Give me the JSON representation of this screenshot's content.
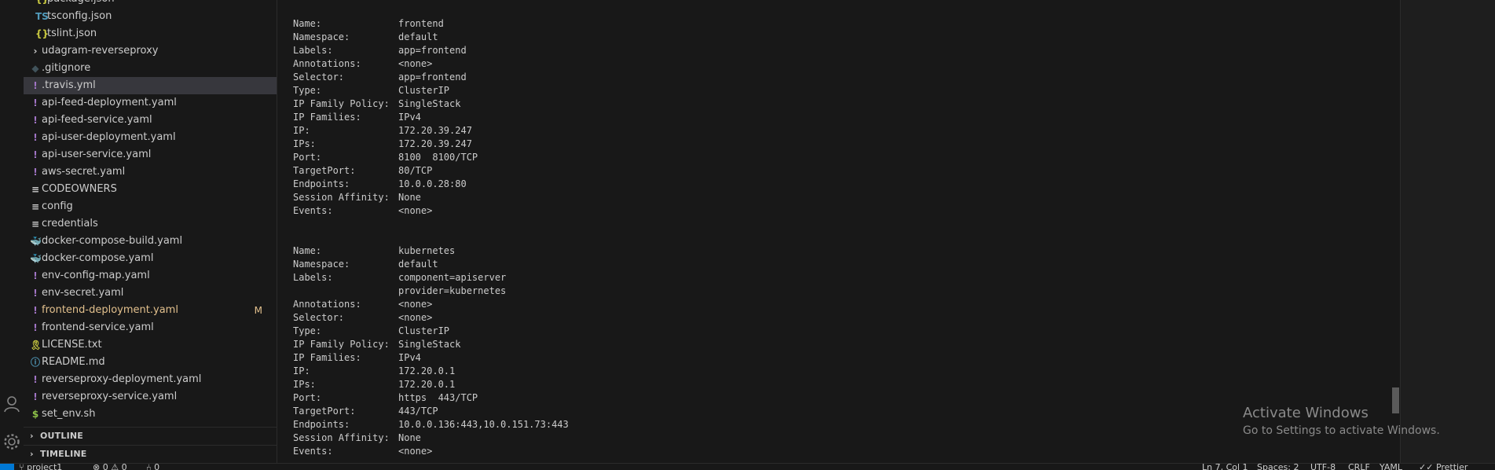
{
  "explorer": {
    "items": [
      {
        "icon": "json-icon",
        "glyph": "{}",
        "color": "#cbcb41",
        "label": "package.json",
        "indent": 2
      },
      {
        "icon": "tsconfig-icon",
        "glyph": "TS",
        "color": "#519aba",
        "label": "tsconfig.json",
        "indent": 2
      },
      {
        "icon": "json-icon",
        "glyph": "{}",
        "color": "#cbcb41",
        "label": "tslint.json",
        "indent": 2
      },
      {
        "icon": "chevron-right-icon",
        "glyph": "›",
        "color": "#cccccc",
        "label": "udagram-reverseproxy",
        "indent": 1
      },
      {
        "icon": "gitignore-icon",
        "glyph": "◆",
        "color": "#41535b",
        "label": ".gitignore",
        "indent": 1
      },
      {
        "icon": "yaml-icon",
        "glyph": "!",
        "color": "#a074c4",
        "label": ".travis.yml",
        "indent": 1,
        "selected": true
      },
      {
        "icon": "yaml-icon",
        "glyph": "!",
        "color": "#a074c4",
        "label": "api-feed-deployment.yaml",
        "indent": 1
      },
      {
        "icon": "yaml-icon",
        "glyph": "!",
        "color": "#a074c4",
        "label": "api-feed-service.yaml",
        "indent": 1
      },
      {
        "icon": "yaml-icon",
        "glyph": "!",
        "color": "#a074c4",
        "label": "api-user-deployment.yaml",
        "indent": 1
      },
      {
        "icon": "yaml-icon",
        "glyph": "!",
        "color": "#a074c4",
        "label": "api-user-service.yaml",
        "indent": 1
      },
      {
        "icon": "yaml-icon",
        "glyph": "!",
        "color": "#a074c4",
        "label": "aws-secret.yaml",
        "indent": 1
      },
      {
        "icon": "text-file-icon",
        "glyph": "≡",
        "color": "#cccccc",
        "label": "CODEOWNERS",
        "indent": 1
      },
      {
        "icon": "text-file-icon",
        "glyph": "≡",
        "color": "#cccccc",
        "label": "config",
        "indent": 1
      },
      {
        "icon": "text-file-icon",
        "glyph": "≡",
        "color": "#cccccc",
        "label": "credentials",
        "indent": 1
      },
      {
        "icon": "docker-icon",
        "glyph": "🐳",
        "color": "#e44d6a",
        "label": "docker-compose-build.yaml",
        "indent": 1
      },
      {
        "icon": "docker-icon",
        "glyph": "🐳",
        "color": "#e44d6a",
        "label": "docker-compose.yaml",
        "indent": 1
      },
      {
        "icon": "yaml-icon",
        "glyph": "!",
        "color": "#a074c4",
        "label": "env-config-map.yaml",
        "indent": 1
      },
      {
        "icon": "yaml-icon",
        "glyph": "!",
        "color": "#a074c4",
        "label": "env-secret.yaml",
        "indent": 1
      },
      {
        "icon": "yaml-icon",
        "glyph": "!",
        "color": "#a074c4",
        "label": "frontend-deployment.yaml",
        "indent": 1,
        "modified": true,
        "badge": "M"
      },
      {
        "icon": "yaml-icon",
        "glyph": "!",
        "color": "#a074c4",
        "label": "frontend-service.yaml",
        "indent": 1
      },
      {
        "icon": "license-icon",
        "glyph": "🎗",
        "color": "#cbcb41",
        "label": "LICENSE.txt",
        "indent": 1
      },
      {
        "icon": "info-icon",
        "glyph": "ⓘ",
        "color": "#519aba",
        "label": "README.md",
        "indent": 1
      },
      {
        "icon": "yaml-icon",
        "glyph": "!",
        "color": "#a074c4",
        "label": "reverseproxy-deployment.yaml",
        "indent": 1
      },
      {
        "icon": "yaml-icon",
        "glyph": "!",
        "color": "#a074c4",
        "label": "reverseproxy-service.yaml",
        "indent": 1
      },
      {
        "icon": "shell-icon",
        "glyph": "$",
        "color": "#8dc149",
        "label": "set_env.sh",
        "indent": 1
      }
    ]
  },
  "sections": {
    "outline": "OUTLINE",
    "timeline": "TIMELINE"
  },
  "terminal": {
    "services": [
      {
        "rows": [
          {
            "key": "Name:",
            "value": "frontend"
          },
          {
            "key": "Namespace:",
            "value": "default"
          },
          {
            "key": "Labels:",
            "value": "app=frontend"
          },
          {
            "key": "Annotations:",
            "value": "<none>"
          },
          {
            "key": "Selector:",
            "value": "app=frontend"
          },
          {
            "key": "Type:",
            "value": "ClusterIP"
          },
          {
            "key": "IP Family Policy:",
            "value": "SingleStack"
          },
          {
            "key": "IP Families:",
            "value": "IPv4"
          },
          {
            "key": "IP:",
            "value": "172.20.39.247"
          },
          {
            "key": "IPs:",
            "value": "172.20.39.247"
          },
          {
            "key": "Port:",
            "value": "8100  8100/TCP"
          },
          {
            "key": "TargetPort:",
            "value": "80/TCP"
          },
          {
            "key": "Endpoints:",
            "value": "10.0.0.28:80"
          },
          {
            "key": "Session Affinity:",
            "value": "None"
          },
          {
            "key": "Events:",
            "value": "<none>"
          }
        ]
      },
      {
        "rows": [
          {
            "key": "Name:",
            "value": "kubernetes"
          },
          {
            "key": "Namespace:",
            "value": "default"
          },
          {
            "key": "Labels:",
            "value": "component=apiserver"
          },
          {
            "key": "",
            "value": "provider=kubernetes"
          },
          {
            "key": "Annotations:",
            "value": "<none>"
          },
          {
            "key": "Selector:",
            "value": "<none>"
          },
          {
            "key": "Type:",
            "value": "ClusterIP"
          },
          {
            "key": "IP Family Policy:",
            "value": "SingleStack"
          },
          {
            "key": "IP Families:",
            "value": "IPv4"
          },
          {
            "key": "IP:",
            "value": "172.20.0.1"
          },
          {
            "key": "IPs:",
            "value": "172.20.0.1"
          },
          {
            "key": "Port:",
            "value": "https  443/TCP"
          },
          {
            "key": "TargetPort:",
            "value": "443/TCP"
          },
          {
            "key": "Endpoints:",
            "value": "10.0.0.136:443,10.0.151.73:443"
          },
          {
            "key": "Session Affinity:",
            "value": "None"
          },
          {
            "key": "Events:",
            "value": "<none>"
          }
        ]
      }
    ]
  },
  "watermark": {
    "title": "Activate Windows",
    "subtitle": "Go to Settings to activate Windows."
  },
  "statusbar": {
    "branch": "project1",
    "problems": "⊗ 0 ⚠ 0",
    "ports": "0",
    "position": "Ln 7, Col 1",
    "spaces": "Spaces: 2",
    "encoding": "UTF-8",
    "eol": "CRLF",
    "language": "YAML",
    "formatter": "Prettier"
  },
  "theme": {
    "accent": "#0078d4",
    "modified": "#e2c08d"
  }
}
